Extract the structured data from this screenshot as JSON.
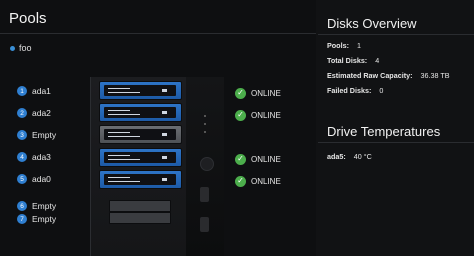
{
  "pools": {
    "title": "Pools",
    "legend": [
      {
        "name": "foo",
        "color": "#3a8fd6"
      }
    ]
  },
  "slots": [
    {
      "num": "1",
      "disk": "ada1",
      "status": "ONLINE",
      "tray": "blue"
    },
    {
      "num": "2",
      "disk": "ada2",
      "status": "ONLINE",
      "tray": "blue"
    },
    {
      "num": "3",
      "disk": "Empty",
      "status": "",
      "tray": "gray"
    },
    {
      "num": "4",
      "disk": "ada3",
      "status": "ONLINE",
      "tray": "blue"
    },
    {
      "num": "5",
      "disk": "ada0",
      "status": "ONLINE",
      "tray": "blue"
    },
    {
      "num": "6",
      "disk": "Empty",
      "status": "",
      "tray": "small"
    },
    {
      "num": "7",
      "disk": "Empty",
      "status": "",
      "tray": "small"
    }
  ],
  "disks_overview": {
    "title": "Disks Overview",
    "stats": [
      {
        "key": "Pools:",
        "value": "1"
      },
      {
        "key": "Total Disks:",
        "value": "4"
      },
      {
        "key": "Estimated Raw Capacity:",
        "value": "36.38 TB"
      },
      {
        "key": "Failed Disks:",
        "value": "0"
      }
    ]
  },
  "drive_temperatures": {
    "title": "Drive Temperatures",
    "items": [
      {
        "key": "ada5:",
        "value": "40 °C"
      }
    ]
  },
  "colors": {
    "accent": "#2f7fd1",
    "online": "#4cae4c",
    "tray_blue": "#2e74c7",
    "tray_gray": "#5c5f64"
  },
  "icons": {
    "status_ok": "check-circle-icon",
    "slot_badge": "number-badge"
  }
}
